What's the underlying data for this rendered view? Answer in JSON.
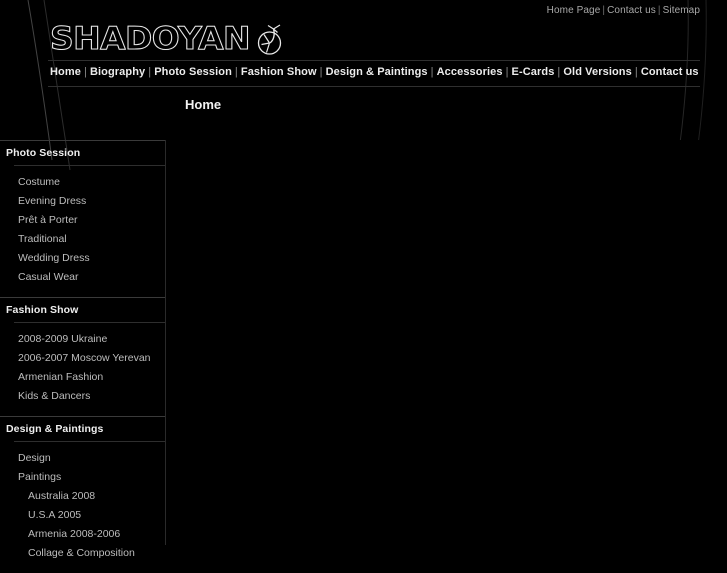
{
  "site": {
    "logo_text": "SHADOYAN",
    "logo_mark_icon": "pomegranate-icon"
  },
  "top_links": [
    {
      "label": "Home Page"
    },
    {
      "label": "Contact us"
    },
    {
      "label": "Sitemap"
    }
  ],
  "nav": [
    {
      "label": "Home"
    },
    {
      "label": "Biography"
    },
    {
      "label": "Photo Session"
    },
    {
      "label": "Fashion Show"
    },
    {
      "label": "Design & Paintings"
    },
    {
      "label": "Accessories"
    },
    {
      "label": "E-Cards"
    },
    {
      "label": "Old Versions"
    },
    {
      "label": "Contact us"
    }
  ],
  "page": {
    "title": "Home"
  },
  "sidebar": {
    "sections": [
      {
        "title": "Photo Session",
        "items": [
          {
            "label": "Costume",
            "indent": false
          },
          {
            "label": "Evening Dress",
            "indent": false
          },
          {
            "label": "Prêt à Porter",
            "indent": false
          },
          {
            "label": "Traditional",
            "indent": false
          },
          {
            "label": "Wedding Dress",
            "indent": false
          },
          {
            "label": "Casual Wear",
            "indent": false
          }
        ]
      },
      {
        "title": "Fashion Show",
        "items": [
          {
            "label": "2008-2009 Ukraine",
            "indent": false
          },
          {
            "label": "2006-2007 Moscow Yerevan",
            "indent": false
          },
          {
            "label": "Armenian Fashion",
            "indent": false
          },
          {
            "label": "Kids & Dancers",
            "indent": false
          }
        ]
      },
      {
        "title": "Design & Paintings",
        "items": [
          {
            "label": "Design",
            "indent": false
          },
          {
            "label": "Paintings",
            "indent": false
          },
          {
            "label": "Australia 2008",
            "indent": true
          },
          {
            "label": "U.S.A 2005",
            "indent": true
          },
          {
            "label": "Armenia 2008-2006",
            "indent": true
          },
          {
            "label": "Collage & Composition",
            "indent": true
          }
        ]
      }
    ]
  },
  "colors": {
    "background": "#000000",
    "text": "#cfcfcf",
    "heading": "#efefef",
    "rule": "#2f2f2f"
  },
  "separator": "|"
}
